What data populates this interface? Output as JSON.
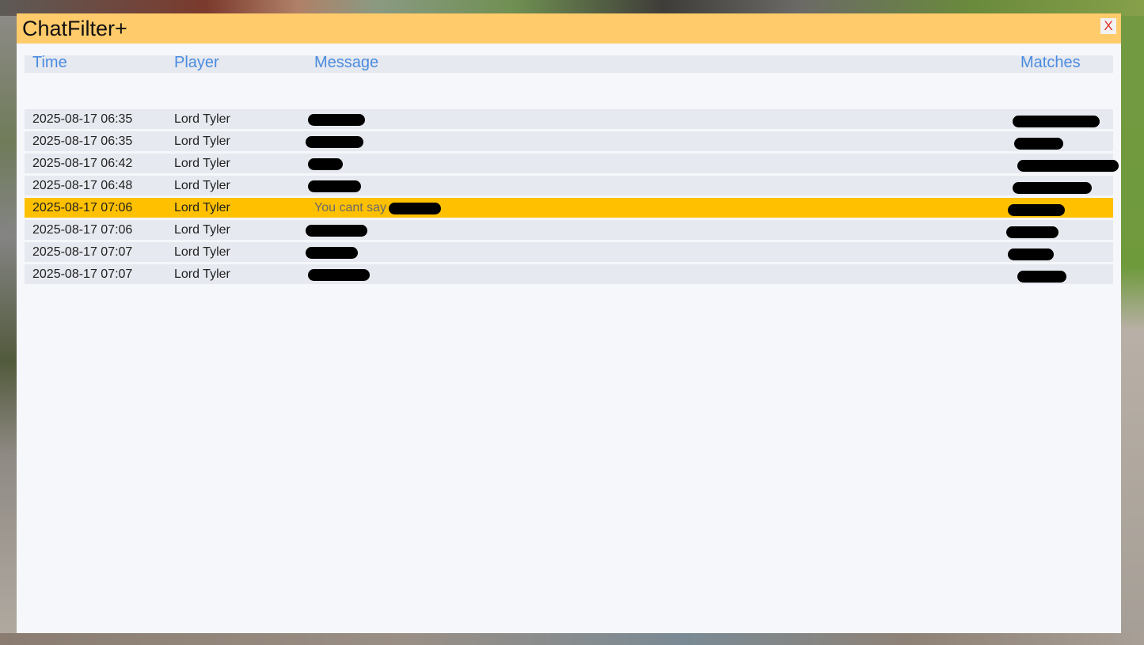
{
  "window": {
    "title": "ChatFilter+",
    "close_label": "X"
  },
  "columns": {
    "time": "Time",
    "player": "Player",
    "message": "Message",
    "matches": "Matches"
  },
  "rows": [
    {
      "time": "2025-08-17 06:35",
      "player": "Lord Tyler",
      "message": "",
      "message_redacted": true,
      "match_redacted": true,
      "selected": false
    },
    {
      "time": "2025-08-17 06:35",
      "player": "Lord Tyler",
      "message": "",
      "message_redacted": true,
      "match_redacted": true,
      "selected": false
    },
    {
      "time": "2025-08-17 06:42",
      "player": "Lord Tyler",
      "message": "",
      "message_redacted": true,
      "match_redacted": true,
      "selected": false
    },
    {
      "time": "2025-08-17 06:48",
      "player": "Lord Tyler",
      "message": "",
      "message_redacted": true,
      "match_redacted": true,
      "selected": false
    },
    {
      "time": "2025-08-17 07:06",
      "player": "Lord Tyler",
      "message": "You cant say",
      "message_redacted": true,
      "match_redacted": true,
      "selected": true
    },
    {
      "time": "2025-08-17 07:06",
      "player": "Lord Tyler",
      "message": "",
      "message_redacted": true,
      "match_redacted": true,
      "selected": false
    },
    {
      "time": "2025-08-17 07:07",
      "player": "Lord Tyler",
      "message": "",
      "message_redacted": true,
      "match_redacted": true,
      "selected": false
    },
    {
      "time": "2025-08-17 07:07",
      "player": "Lord Tyler",
      "message": "",
      "message_redacted": true,
      "match_redacted": true,
      "selected": false
    }
  ],
  "colors": {
    "titlebar": "#ffcb6b",
    "header_text": "#4a8be0",
    "row_bg": "#e6e9ef",
    "selected_row": "#ffc000",
    "close_x": "#e0302a"
  }
}
